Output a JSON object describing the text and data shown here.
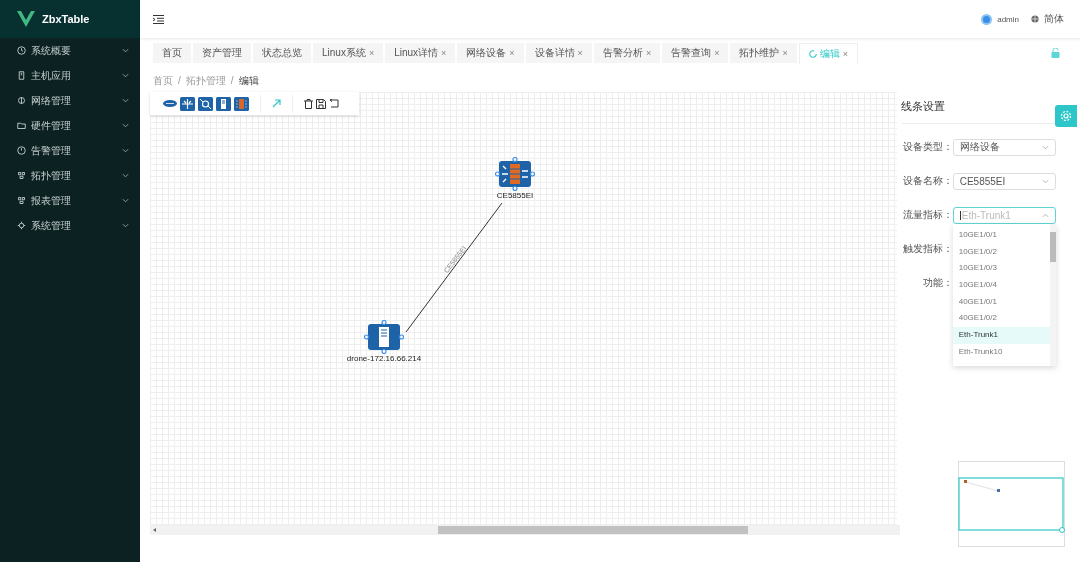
{
  "sidebar": {
    "logo": "ZbxTable",
    "items": [
      {
        "label": "系统概要"
      },
      {
        "label": "主机应用"
      },
      {
        "label": "网络管理"
      },
      {
        "label": "硬件管理"
      },
      {
        "label": "告警管理"
      },
      {
        "label": "拓扑管理"
      },
      {
        "label": "报表管理"
      },
      {
        "label": "系统管理"
      }
    ]
  },
  "header": {
    "user": "admin",
    "language": "简体"
  },
  "tabs": [
    {
      "label": "首页",
      "selected": false
    },
    {
      "label": "资产管理",
      "selected": false
    },
    {
      "label": "状态总览",
      "selected": false
    },
    {
      "label": "Linux系统",
      "close": "×",
      "selected": false
    },
    {
      "label": "Linux详情",
      "close": "×",
      "selected": false
    },
    {
      "label": "网络设备",
      "close": "×",
      "selected": false
    },
    {
      "label": "设备详情",
      "close": "×",
      "selected": false
    },
    {
      "label": "告警分析",
      "close": "×",
      "selected": false
    },
    {
      "label": "告警查询",
      "close": "×",
      "selected": false
    },
    {
      "label": "拓扑维护",
      "close": "×",
      "selected": false
    },
    {
      "label": "编辑",
      "close": "×",
      "selected": true
    }
  ],
  "breadcrumb": {
    "separator": "/",
    "items": [
      "首页",
      "拓扑管理",
      "编辑"
    ]
  },
  "canvas": {
    "nodes": [
      {
        "label": "CE5855EI",
        "kind": "switch"
      },
      {
        "label": "drone-172.16.66.214",
        "kind": "server"
      }
    ],
    "link": {
      "label": "CE5855EI"
    }
  },
  "panel": {
    "title": "线条设置",
    "fields": [
      {
        "label": "设备类型：",
        "kind": "select",
        "value": "网络设备"
      },
      {
        "label": "设备名称：",
        "kind": "select",
        "value": "CE5855EI"
      },
      {
        "label": "流量指标：",
        "kind": "select",
        "placeholder": "Eth-Trunk1",
        "open": true
      },
      {
        "label": "触发指标：",
        "kind": "covered"
      },
      {
        "label": "功能：",
        "kind": "covered"
      }
    ],
    "options": [
      {
        "label": "10GE1/0/1",
        "selected": false
      },
      {
        "label": "10GE1/0/2",
        "selected": false
      },
      {
        "label": "10GE1/0/3",
        "selected": false
      },
      {
        "label": "10GE1/0/4",
        "selected": false
      },
      {
        "label": "40GE1/0/1",
        "selected": false
      },
      {
        "label": "40GE1/0/2",
        "selected": false
      },
      {
        "label": "Eth-Trunk1",
        "selected": true
      },
      {
        "label": "Eth-Trunk10",
        "selected": false
      }
    ]
  }
}
